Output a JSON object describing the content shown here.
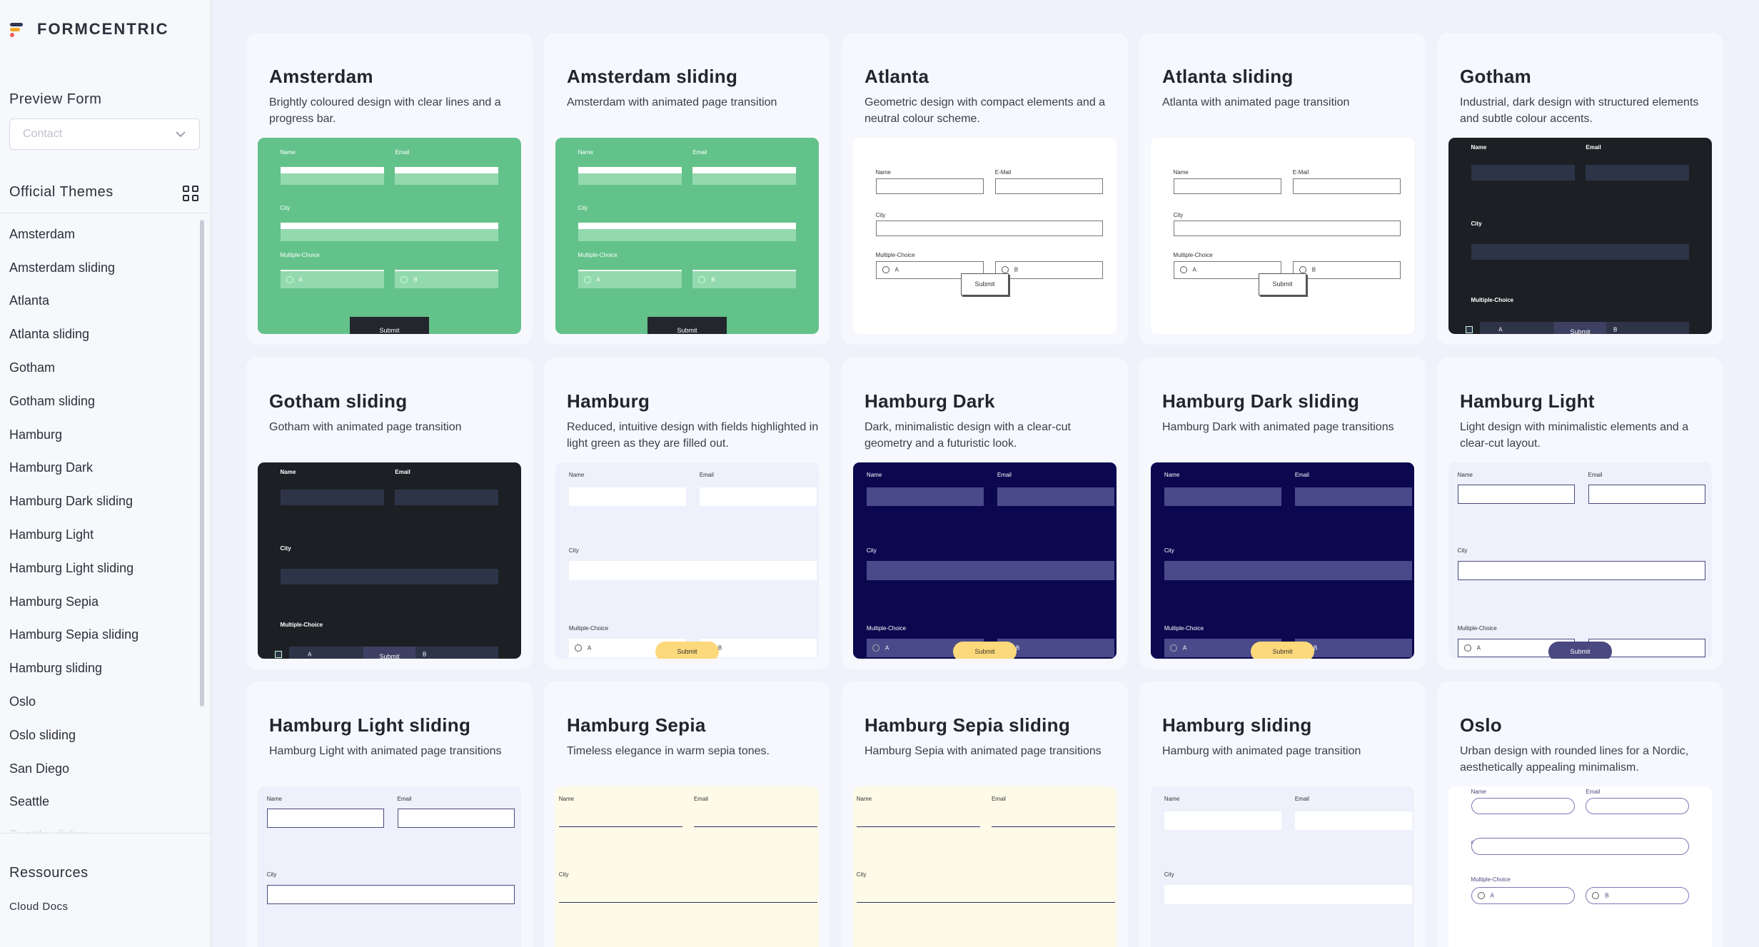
{
  "app": {
    "name": "FORMCENTRIC"
  },
  "sidebar": {
    "preview_title": "Preview Form",
    "preview_select_value": "Contact",
    "themes_title": "Official Themes",
    "themes": [
      "Amsterdam",
      "Amsterdam sliding",
      "Atlanta",
      "Atlanta sliding",
      "Gotham",
      "Gotham sliding",
      "Hamburg",
      "Hamburg Dark",
      "Hamburg Dark sliding",
      "Hamburg Light",
      "Hamburg Light sliding",
      "Hamburg Sepia",
      "Hamburg Sepia sliding",
      "Hamburg sliding",
      "Oslo",
      "Oslo sliding",
      "San Diego",
      "Seattle",
      "Seattle sliding"
    ],
    "resources_title": "Ressources",
    "resources_link": "Cloud Docs"
  },
  "cards": [
    {
      "title": "Amsterdam",
      "desc": "Brightly coloured design with clear lines and a progress bar.",
      "style": "amsterdam"
    },
    {
      "title": "Amsterdam sliding",
      "desc": "Amsterdam with animated page transition",
      "style": "amsterdam"
    },
    {
      "title": "Atlanta",
      "desc": "Geometric design with compact elements and a neutral colour scheme.",
      "style": "atlanta"
    },
    {
      "title": "Atlanta sliding",
      "desc": "Atlanta with animated page transition",
      "style": "atlanta"
    },
    {
      "title": "Gotham",
      "desc": "Industrial, dark design with structured elements and subtle colour accents.",
      "style": "gotham"
    },
    {
      "title": "Gotham sliding",
      "desc": "Gotham with animated page transition",
      "style": "gotham"
    },
    {
      "title": "Hamburg",
      "desc": "Reduced, intuitive design with fields highlighted in light green as they are filled out.",
      "style": "hamburg"
    },
    {
      "title": "Hamburg Dark",
      "desc": "Dark, minimalistic design with a clear-cut geometry and a futuristic look.",
      "style": "hamburgdark"
    },
    {
      "title": "Hamburg Dark sliding",
      "desc": "Hamburg Dark with animated page transitions",
      "style": "hamburgdark"
    },
    {
      "title": "Hamburg Light",
      "desc": "Light design with minimalistic elements and a clear-cut layout.",
      "style": "hamburglight"
    },
    {
      "title": "Hamburg Light sliding",
      "desc": "Hamburg Light with animated page transitions",
      "style": "hamburglight"
    },
    {
      "title": "Hamburg Sepia",
      "desc": "Timeless elegance in warm sepia tones.",
      "style": "sepia"
    },
    {
      "title": "Hamburg Sepia sliding",
      "desc": "Hamburg Sepia with animated page transitions",
      "style": "sepia"
    },
    {
      "title": "Hamburg sliding",
      "desc": "Hamburg with animated page transition",
      "style": "hamburg"
    },
    {
      "title": "Oslo",
      "desc": "Urban design with rounded lines for a Nordic, aesthetically appealing minimalism.",
      "style": "oslo"
    }
  ],
  "form": {
    "name": "Name",
    "email": "Email",
    "email_atlanta": "E-Mail",
    "city": "City",
    "multiple_choice": "Multiple-Choice",
    "option_a": "A",
    "option_b": "B",
    "submit": "Submit"
  },
  "colors": {
    "amsterdam_green": "#63c28a",
    "gotham_bg": "#1c2024",
    "hamburg_dark_bg": "#0b0850",
    "submit_yellow": "#fcd97a",
    "light_submit": "#4a4880",
    "sepia_bg": "#fdfbe8"
  }
}
